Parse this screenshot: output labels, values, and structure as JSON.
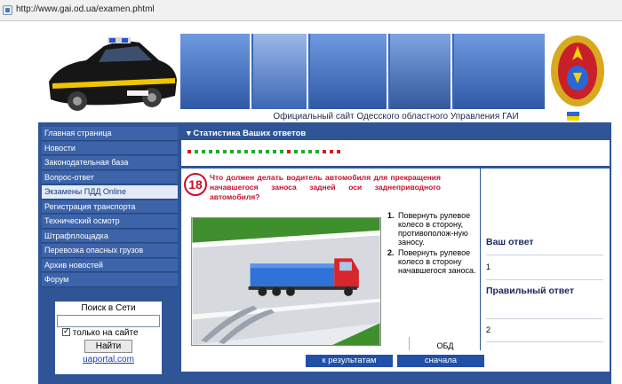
{
  "browser": {
    "url": "http://www.gai.od.ua/examen.phtml"
  },
  "banner": {
    "caption": "Официальный сайт Одесского областного Управления ГАИ",
    "colors": {
      "flag_top": "#2b66d6",
      "flag_bottom": "#f5d400"
    }
  },
  "menu": {
    "items": [
      "Главная страница",
      "Новости",
      "Законодательная база",
      "Вопрос-ответ",
      "Экзамены ПДД Online",
      "Регистрация транспорта",
      "Технический осмотр",
      "Штрафплощадка",
      "Перевозка опасных грузов",
      "Архив новостей",
      "Форум"
    ],
    "active_index": 4
  },
  "search": {
    "title": "Поиск в Сети",
    "query": "",
    "only_site_label": "только на сайте",
    "only_site_checked": true,
    "find_button": "Найти",
    "link": "uaportal.com"
  },
  "stats": {
    "title": "Статистика Ваших ответов",
    "dots": [
      "r",
      "g",
      "g",
      "g",
      "g",
      "g",
      "g",
      "g",
      "g",
      "g",
      "g",
      "g",
      "g",
      "g",
      "r",
      "g",
      "g",
      "g",
      "g",
      "r",
      "r",
      "r"
    ],
    "colors": {
      "green": "#1faa2e",
      "red": "#d7191c"
    }
  },
  "question": {
    "number": "18",
    "text": "Что должен делать водитель автомобиля для прекращения начавшегося заноса задней оси заднеприводного автомобиля?",
    "answers": [
      {
        "num": "1.",
        "text": "Повернуть рулевое колесо в сторону, противополож-ную заносу."
      },
      {
        "num": "2.",
        "text": "Повернуть рулевое колесо в сторону начавшегося заноса."
      }
    ],
    "obd": "ОБД"
  },
  "results": {
    "your_answer_label": "Ваш ответ",
    "your_answer": "1",
    "correct_answer_label": "Правильный ответ",
    "correct_answer": "2"
  },
  "buttons": {
    "to_results": "к результатам",
    "restart": "сначала"
  }
}
